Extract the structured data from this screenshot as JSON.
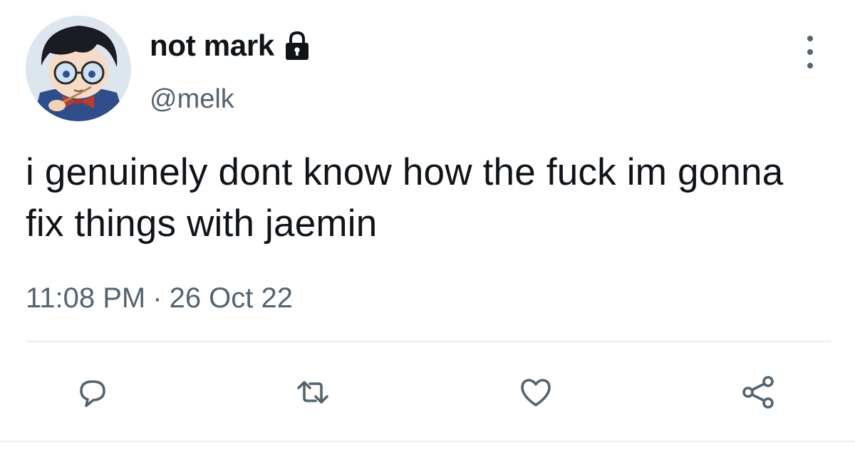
{
  "author": {
    "display_name": "not mark",
    "handle": "@melk",
    "protected": true,
    "avatar": "anime-character-avatar"
  },
  "tweet": {
    "text": "i genuinely dont know how the fuck im gonna fix things with jaemin",
    "time": "11:08 PM",
    "separator": "·",
    "date": "26 Oct 22"
  },
  "icons": {
    "lock": "lock-icon",
    "more": "more-vertical-icon",
    "reply": "reply-icon",
    "retweet": "retweet-icon",
    "like": "heart-icon",
    "share": "share-icon"
  },
  "colors": {
    "text": "#0f1419",
    "secondary": "#536471",
    "divider": "#e6ecf0"
  }
}
